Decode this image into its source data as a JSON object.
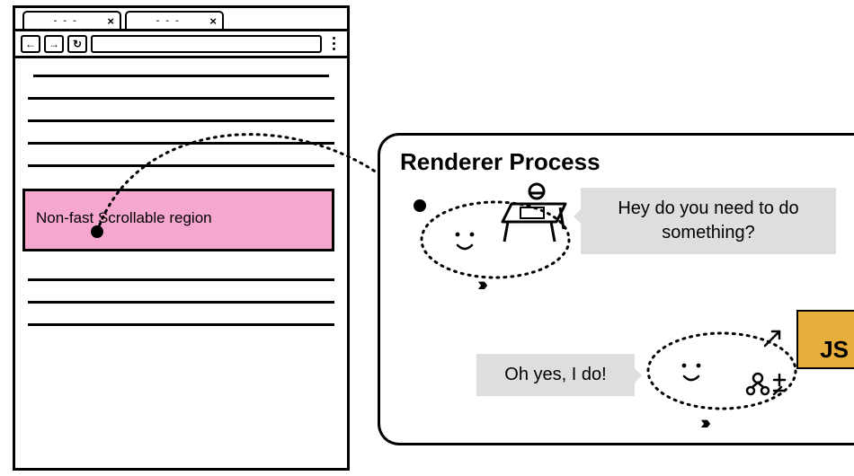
{
  "browser": {
    "tab_close_glyph": "×",
    "tab_dashes": "- - -",
    "nav_back": "←",
    "nav_fwd": "→",
    "nav_reload": "↻"
  },
  "nonfast_label": "Non-fast Scrollable region",
  "renderer": {
    "title": "Renderer Process",
    "speech_top": "Hey do you need to do something?",
    "speech_bottom": "Oh yes, I do!",
    "js_label": "JS"
  },
  "chevrons": "›››"
}
